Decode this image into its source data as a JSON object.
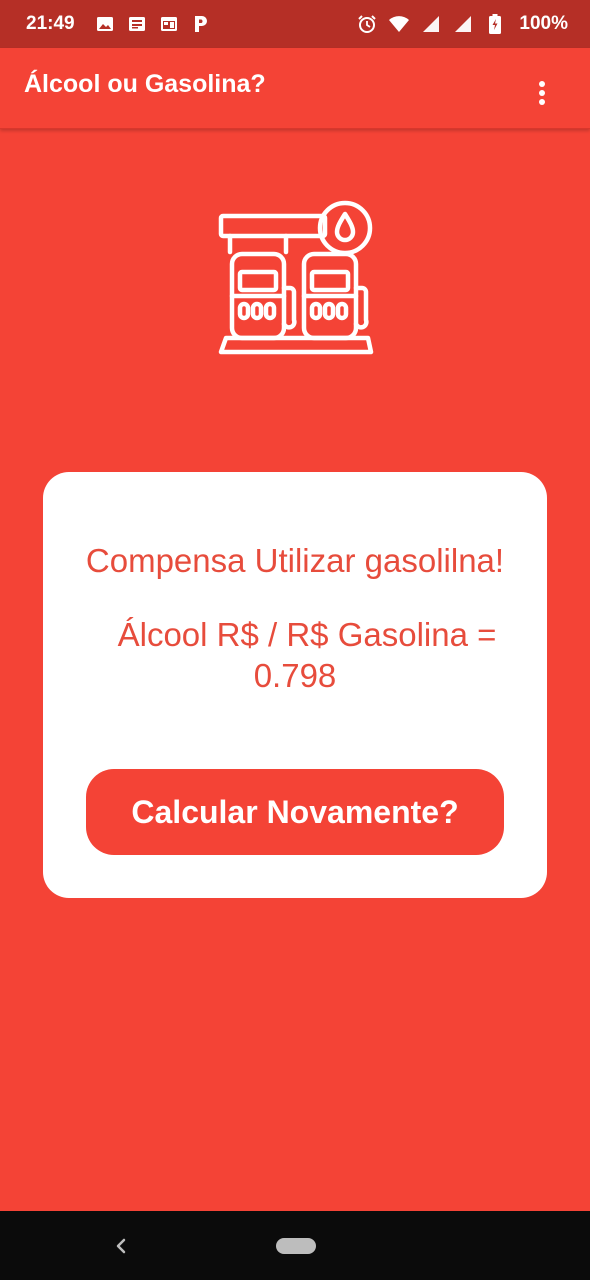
{
  "status_bar": {
    "time": "21:49",
    "battery": "100%",
    "left_icons": [
      "image-icon",
      "news-icon",
      "calendar-icon",
      "p-icon"
    ],
    "right_icons": [
      "alarm-icon",
      "wifi-icon",
      "signal-icon",
      "signal-icon",
      "battery-icon"
    ]
  },
  "app_bar": {
    "title": "Álcool ou Gasolina?"
  },
  "illustration": {
    "icon": "gas-station-pump-icon"
  },
  "result": {
    "title": "Compensa Utilizar gasolilna!",
    "ratio_label": "Álcool R$ / R$ Gasolina =",
    "ratio_value": "0.798",
    "button_label": "Calcular Novamente?"
  },
  "colors": {
    "primary": "#f44336",
    "status_bar": "#b52f26",
    "text_accent": "#e74c3c",
    "card": "#ffffff"
  }
}
